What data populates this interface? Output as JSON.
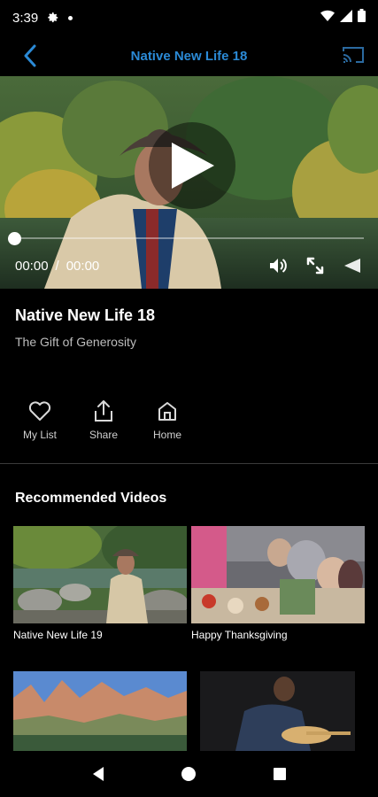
{
  "status_bar": {
    "time": "3:39",
    "icons": [
      "settings-icon",
      "notification-dot-icon",
      "wifi-icon",
      "signal-icon",
      "battery-icon"
    ]
  },
  "app_bar": {
    "title": "Native New Life 18",
    "back_icon": "back-chevron-icon",
    "cast_icon": "cast-icon"
  },
  "player": {
    "current_time": "00:00",
    "separator": "/",
    "duration": "00:00",
    "progress": 0,
    "controls": [
      "volume-icon",
      "fullscreen-icon",
      "cast-icon"
    ]
  },
  "video": {
    "title": "Native New Life 18",
    "subtitle": "The Gift of Generosity"
  },
  "actions": [
    {
      "label": "My List",
      "icon": "heart-icon"
    },
    {
      "label": "Share",
      "icon": "share-icon"
    },
    {
      "label": "Home",
      "icon": "home-icon"
    }
  ],
  "recommended": {
    "section_title": "Recommended Videos",
    "items": [
      {
        "title": "Native New Life 19"
      },
      {
        "title": "Happy Thanksgiving"
      },
      {
        "title": ""
      },
      {
        "title": ""
      }
    ]
  },
  "nav": [
    "back-triangle-icon",
    "home-circle-icon",
    "recents-square-icon"
  ],
  "colors": {
    "accent": "#2b8ad6",
    "background": "#000000",
    "divider": "#3a3a3a"
  }
}
